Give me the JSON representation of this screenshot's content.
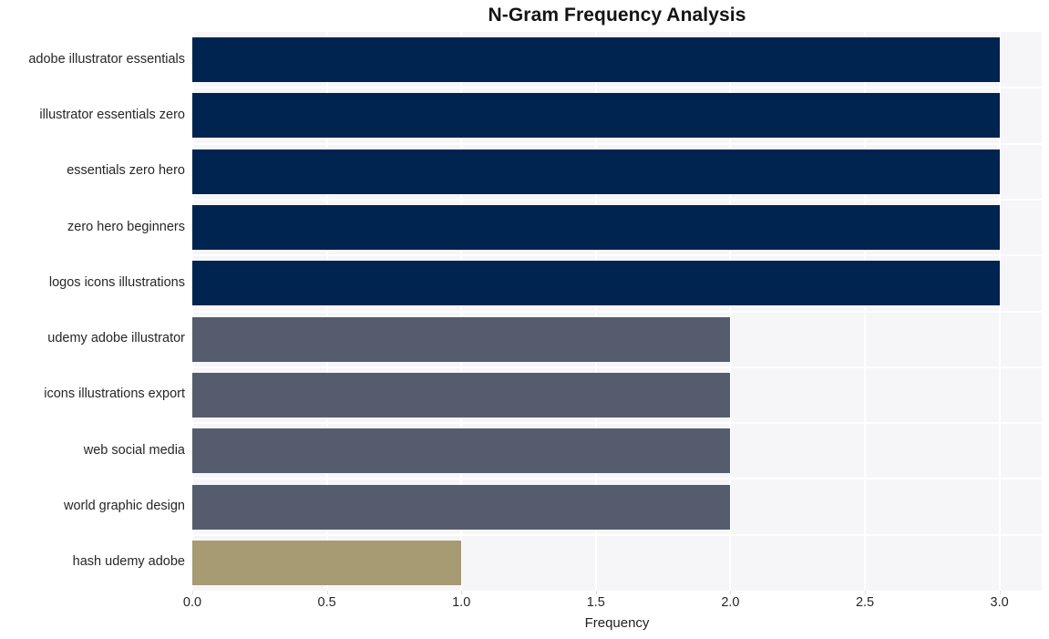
{
  "chart_data": {
    "type": "bar",
    "orientation": "horizontal",
    "title": "N-Gram Frequency Analysis",
    "xlabel": "Frequency",
    "ylabel": "",
    "xlim": [
      0,
      3.157
    ],
    "xticks": [
      "0.0",
      "0.5",
      "1.0",
      "1.5",
      "2.0",
      "2.5",
      "3.0"
    ],
    "xtick_values": [
      0.0,
      0.5,
      1.0,
      1.5,
      2.0,
      2.5,
      3.0
    ],
    "grid": true,
    "legend": "none",
    "categories": [
      "adobe illustrator essentials",
      "illustrator essentials zero",
      "essentials zero hero",
      "zero hero beginners",
      "logos icons illustrations",
      "udemy adobe illustrator",
      "icons illustrations export",
      "web social media",
      "world graphic design",
      "hash udemy adobe"
    ],
    "values": [
      3,
      3,
      3,
      3,
      3,
      2,
      2,
      2,
      2,
      1
    ],
    "bar_colors": [
      "#002450",
      "#002450",
      "#002450",
      "#002450",
      "#002450",
      "#555c6e",
      "#555c6e",
      "#555c6e",
      "#555c6e",
      "#a69b72"
    ],
    "palette": {
      "high": "#002450",
      "mid": "#555c6e",
      "low": "#a69b72",
      "plot_background": "#f6f6f8",
      "gridline": "#ffffff",
      "figure_background": "#ffffff",
      "text": "#262626"
    }
  }
}
